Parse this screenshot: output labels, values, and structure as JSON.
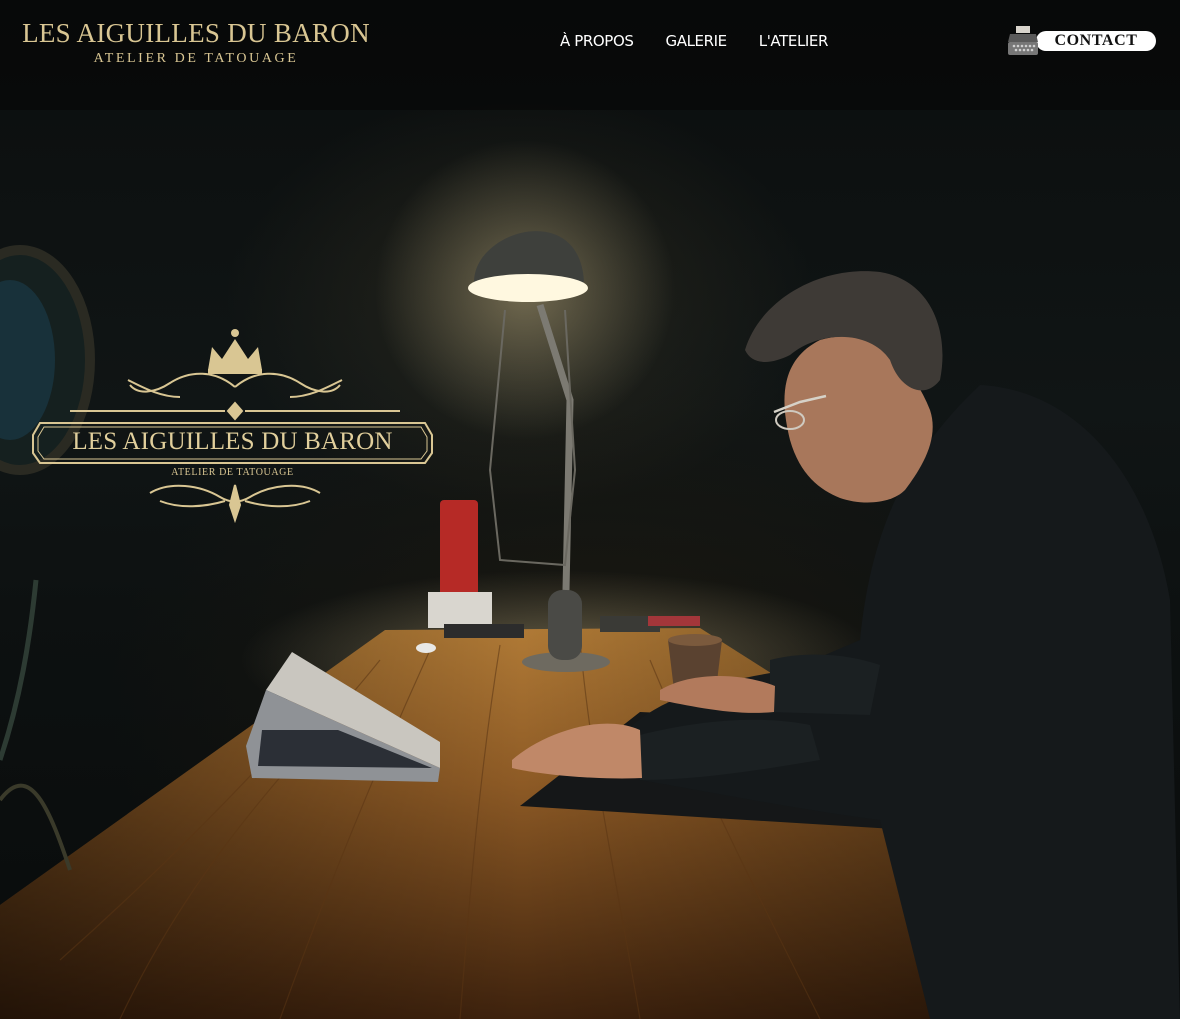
{
  "brand": {
    "name": "LES AIGUILLES DU BARON",
    "tagline": "ATELIER DE TATOUAGE"
  },
  "nav": {
    "items": [
      {
        "label": "À PROPOS"
      },
      {
        "label": "GALERIE"
      },
      {
        "label": "L'ATELIER"
      }
    ]
  },
  "contact": {
    "label": "CONTACT",
    "icon": "typewriter-icon"
  },
  "hero": {
    "emblem_title": "LES AIGUILLES DU BARON",
    "emblem_subtitle": "ATELIER DE TATOUAGE",
    "emblem_icons": [
      "crown-icon",
      "ornament-icon"
    ]
  },
  "colors": {
    "gold": "#d9c693",
    "background": "#0b0e0e",
    "button": "#ffffff"
  }
}
